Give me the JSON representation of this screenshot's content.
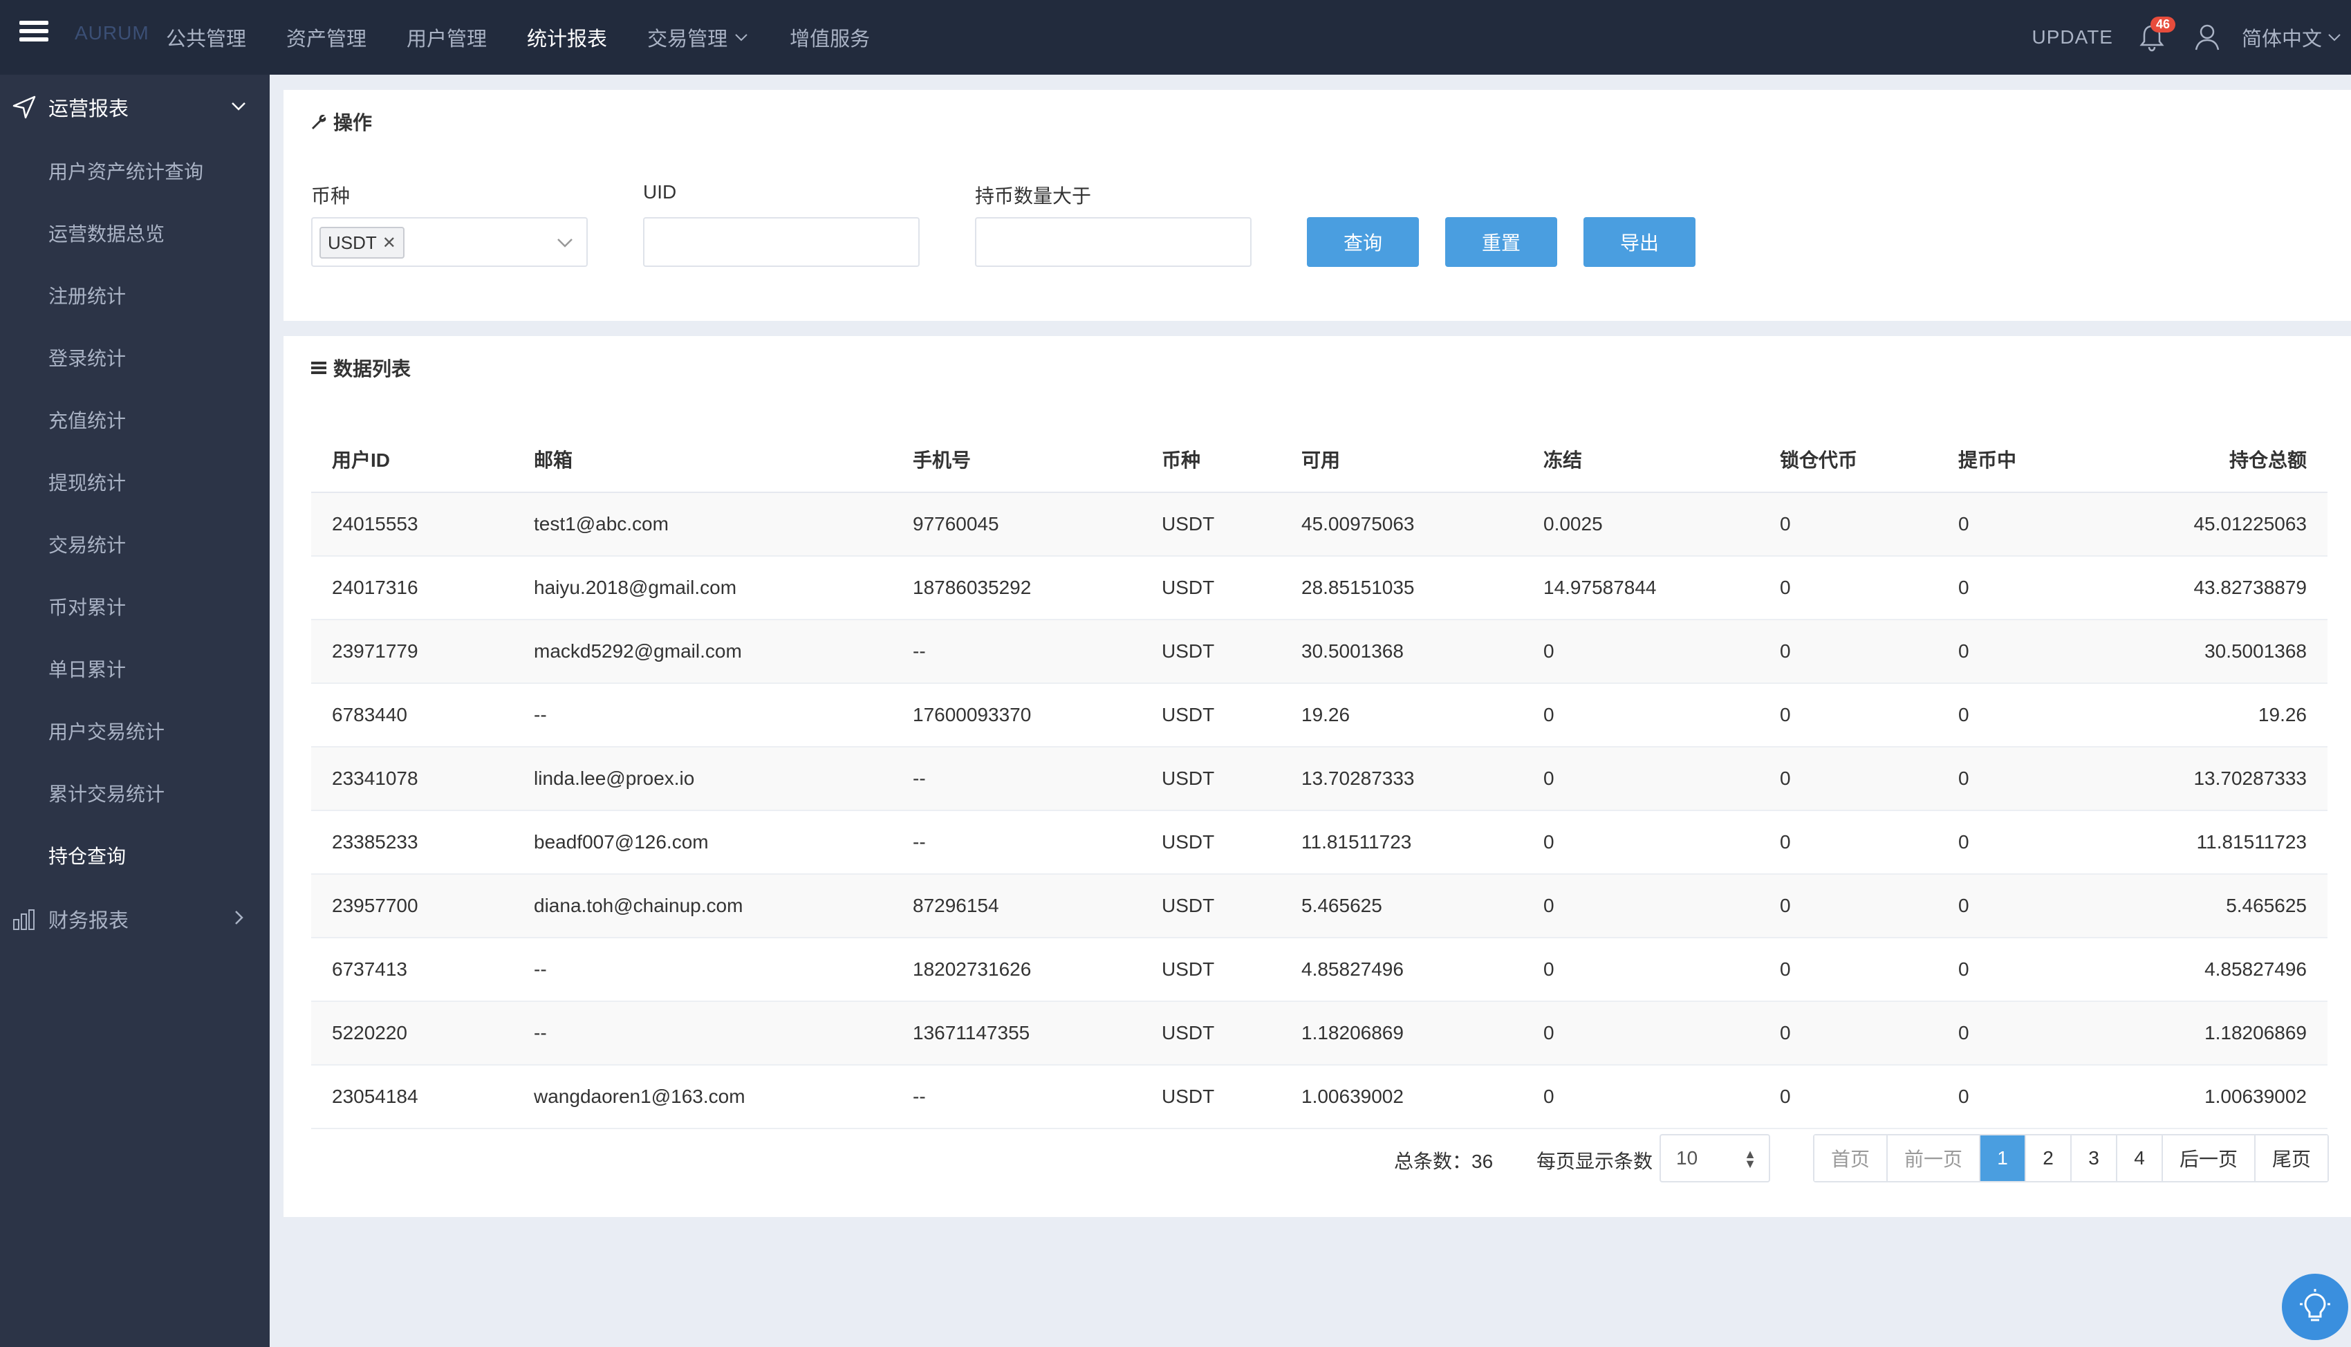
{
  "header": {
    "logo_text": "AURUM",
    "nav": [
      "公共管理",
      "资产管理",
      "用户管理",
      "统计报表",
      "交易管理",
      "增值服务"
    ],
    "update_label": "UPDATE",
    "notification_count": "46",
    "language": "简体中文"
  },
  "sidebar": {
    "group_open": "运营报表",
    "items": [
      "用户资产统计查询",
      "运营数据总览",
      "注册统计",
      "登录统计",
      "充值统计",
      "提现统计",
      "交易统计",
      "币对累计",
      "单日累计",
      "用户交易统计",
      "累计交易统计",
      "持仓查询"
    ],
    "active_item": "持仓查询",
    "group_closed": "财务报表"
  },
  "operations": {
    "title": "操作",
    "currency_label": "币种",
    "currency_tag": "USDT",
    "uid_label": "UID",
    "uid_value": "",
    "amount_label": "持币数量大于",
    "amount_value": "",
    "query_btn": "查询",
    "reset_btn": "重置",
    "export_btn": "导出"
  },
  "list": {
    "title": "数据列表",
    "columns": [
      "用户ID",
      "邮箱",
      "手机号",
      "币种",
      "可用",
      "冻结",
      "锁仓代币",
      "提币中",
      "持仓总额"
    ],
    "rows": [
      [
        "24015553",
        "test1@abc.com",
        "97760045",
        "USDT",
        "45.00975063",
        "0.0025",
        "0",
        "0",
        "45.01225063"
      ],
      [
        "24017316",
        "haiyu.2018@gmail.com",
        "18786035292",
        "USDT",
        "28.85151035",
        "14.97587844",
        "0",
        "0",
        "43.82738879"
      ],
      [
        "23971779",
        "mackd5292@gmail.com",
        "--",
        "USDT",
        "30.5001368",
        "0",
        "0",
        "0",
        "30.5001368"
      ],
      [
        "6783440",
        "--",
        "17600093370",
        "USDT",
        "19.26",
        "0",
        "0",
        "0",
        "19.26"
      ],
      [
        "23341078",
        "linda.lee@proex.io",
        "--",
        "USDT",
        "13.70287333",
        "0",
        "0",
        "0",
        "13.70287333"
      ],
      [
        "23385233",
        "beadf007@126.com",
        "--",
        "USDT",
        "11.81511723",
        "0",
        "0",
        "0",
        "11.81511723"
      ],
      [
        "23957700",
        "diana.toh@chainup.com",
        "87296154",
        "USDT",
        "5.465625",
        "0",
        "0",
        "0",
        "5.465625"
      ],
      [
        "6737413",
        "--",
        "18202731626",
        "USDT",
        "4.85827496",
        "0",
        "0",
        "0",
        "4.85827496"
      ],
      [
        "5220220",
        "--",
        "13671147355",
        "USDT",
        "1.18206869",
        "0",
        "0",
        "0",
        "1.18206869"
      ],
      [
        "23054184",
        "wangdaoren1@163.com",
        "--",
        "USDT",
        "1.00639002",
        "0",
        "0",
        "0",
        "1.00639002"
      ]
    ]
  },
  "pagination": {
    "total_text": "总条数：36",
    "per_page_label": "每页显示条数",
    "per_page_value": "10",
    "first": "首页",
    "prev": "前一页",
    "pages": [
      "1",
      "2",
      "3",
      "4"
    ],
    "current_page": "1",
    "next": "后一页",
    "last": "尾页"
  },
  "colors": {
    "topbar": "#222b3d",
    "sidebar": "#2c3447",
    "accent": "#4a9ee0",
    "badge": "#e74c3c"
  },
  "icons": [
    "menu-icon",
    "bell-icon",
    "user-icon",
    "send-icon",
    "chevron-down-icon",
    "bar-chart-icon",
    "chevron-right-icon",
    "wrench-icon",
    "list-icon",
    "close-icon",
    "lightbulb-icon"
  ]
}
